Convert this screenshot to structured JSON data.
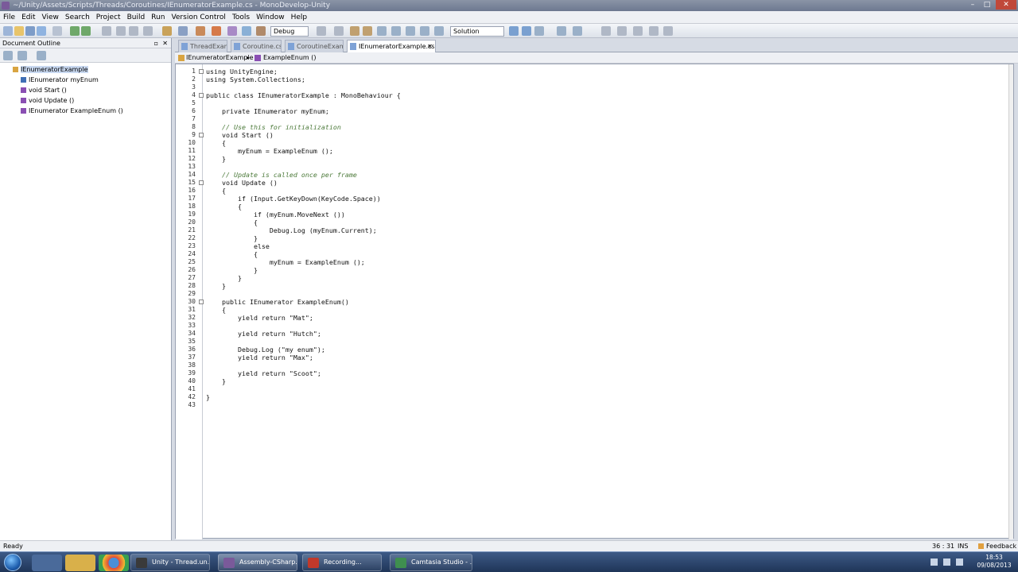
{
  "window": {
    "title": "IEnumeratorExample.cs - MonoDevelop-Unity",
    "title_prefix": "~/Unity/Assets/Scripts/Threads/Coroutines/",
    "minimize": "–",
    "maximize": "□",
    "close": "✕"
  },
  "menu": [
    "File",
    "Edit",
    "View",
    "Search",
    "Project",
    "Build",
    "Run",
    "Version Control",
    "Tools",
    "Window",
    "Help"
  ],
  "toolbar": {
    "config_value": "Debug",
    "solution_value": "Solution"
  },
  "sidebar": {
    "title": "Document Outline",
    "items": [
      {
        "label": "IEnumeratorExample",
        "icon": "class-icon",
        "color": "#d9a441"
      },
      {
        "label": "IEnumerator myEnum",
        "icon": "field-icon",
        "color": "#3f6fb5"
      },
      {
        "label": "void Start ()",
        "icon": "method-icon",
        "color": "#8a4fb3"
      },
      {
        "label": "void Update ()",
        "icon": "method-icon",
        "color": "#8a4fb3"
      },
      {
        "label": "IEnumerator ExampleEnum ()",
        "icon": "method-icon",
        "color": "#8a4fb3"
      }
    ]
  },
  "tabs": [
    {
      "label": "ThreadExample.cs",
      "active": false
    },
    {
      "label": "Coroutine.cs",
      "active": false
    },
    {
      "label": "CoroutineExample.cs",
      "active": false
    },
    {
      "label": "IEnumeratorExample.cs",
      "active": true,
      "close": "✕"
    }
  ],
  "pathbar": {
    "class": "IEnumeratorExample",
    "member": "ExampleEnum ()"
  },
  "code": {
    "lines": [
      "using UnityEngine;",
      "using System.Collections;",
      "",
      "public class IEnumeratorExample : MonoBehaviour {",
      "",
      "    private IEnumerator myEnum;",
      "",
      "    // Use this for initialization",
      "    void Start ()",
      "    {",
      "        myEnum = ExampleEnum ();",
      "    }",
      "",
      "    // Update is called once per frame",
      "    void Update ()",
      "    {",
      "        if (Input.GetKeyDown(KeyCode.Space))",
      "        {",
      "            if (myEnum.MoveNext ())",
      "            {",
      "                Debug.Log (myEnum.Current);",
      "            }",
      "            else",
      "            {",
      "                myEnum = ExampleEnum ();",
      "            }",
      "        }",
      "    }",
      "",
      "    public IEnumerator ExampleEnum()",
      "    {",
      "        yield return \"Mat\";",
      "",
      "        yield return \"Hutch\";",
      "",
      "        Debug.Log (\"my enum\");",
      "        yield return \"Max\";",
      "",
      "        yield return \"Scoot\";",
      "    }",
      "",
      "}",
      ""
    ],
    "comment_lines": [
      8,
      14
    ]
  },
  "status": {
    "left": "Ready",
    "position": "36 : 31",
    "mode": "INS",
    "feedback": "Feedback"
  },
  "taskbar": {
    "tasks": [
      {
        "label": "Unity - Thread.un...",
        "color": "#3a3a3a"
      },
      {
        "label": "Assembly-CSharp...",
        "color": "#7a5a9a"
      },
      {
        "label": "Recording...",
        "color": "#c0392b"
      },
      {
        "label": "Camtasia Studio - ...",
        "color": "#3f8f4f"
      }
    ],
    "clock_time": "18:53",
    "clock_date": "09/08/2013"
  }
}
